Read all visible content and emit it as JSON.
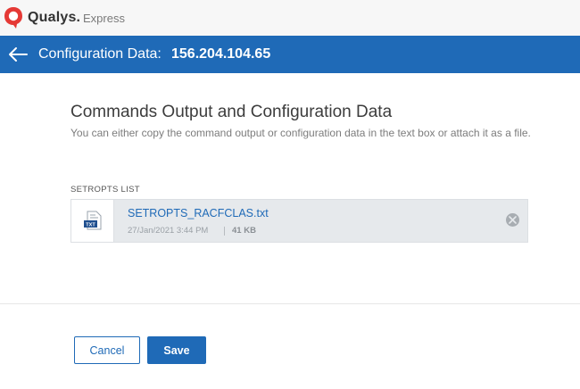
{
  "brand": {
    "name": "Qualys.",
    "product": "Express",
    "logo_icon": "qualys-shield-logo",
    "logo_color": "#e53935"
  },
  "header": {
    "back_icon": "arrow-left-icon",
    "title_label": "Configuration Data:",
    "title_value": "156.204.104.65",
    "bar_color": "#1f6ab7"
  },
  "main": {
    "heading": "Commands Output and Configuration Data",
    "description": "You can either copy the command output or configuration data in the text box or attach it as a file.",
    "section_label": "SETROPTS LIST",
    "attachment": {
      "icon": "txt-file-icon",
      "icon_label": "TXT",
      "file_name": "SETROPTS_RACFCLAS.txt",
      "date": "27/Jan/2021 3:44 PM",
      "size": "41 KB",
      "remove_icon": "remove-circle-icon"
    }
  },
  "footer": {
    "cancel_label": "Cancel",
    "save_label": "Save",
    "accent_color": "#1f6ab7"
  }
}
